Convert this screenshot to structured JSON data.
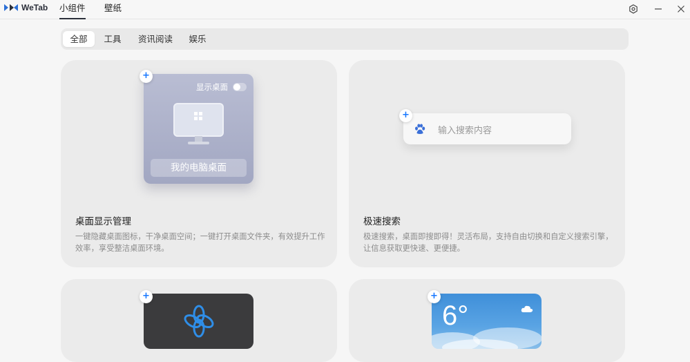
{
  "app": {
    "name": "WeTab",
    "brand_color": "#2b2f3a",
    "accent": "#1677ff"
  },
  "nav": {
    "widgets": "小组件",
    "wallpaper": "壁纸"
  },
  "window": {
    "settings_icon": "hex-gear-icon",
    "minimize_icon": "minimize-icon",
    "close_icon": "close-icon"
  },
  "tabs": [
    {
      "label": "全部",
      "active": true
    },
    {
      "label": "工具"
    },
    {
      "label": "资讯阅读"
    },
    {
      "label": "娱乐"
    }
  ],
  "cards": [
    {
      "title": "桌面显示管理",
      "desc": "一键隐藏桌面图标，干净桌面空间；一键打开桌面文件夹，有效提升工作效率，享受整洁桌面环境。",
      "preview": {
        "toggle_label": "显示桌面",
        "label": "我的电脑桌面"
      }
    },
    {
      "title": "极速搜索",
      "desc": "极速搜索，桌面即搜即得！灵活布局，支持自由切换和自定义搜索引擎，让信息获取更快速、更便捷。",
      "preview": {
        "placeholder": "输入搜索内容",
        "engine_icon": "baidu-paw-icon"
      }
    },
    {
      "title": "",
      "desc": "",
      "preview": {
        "icon": "flower-logo-icon"
      }
    },
    {
      "title": "",
      "desc": "",
      "preview": {
        "temperature": "6°",
        "weather_icon": "cloud-icon"
      }
    }
  ]
}
